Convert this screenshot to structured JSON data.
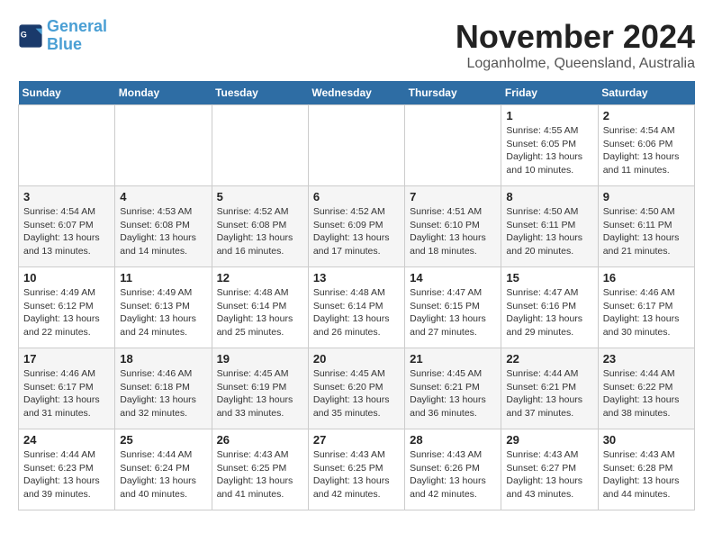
{
  "header": {
    "logo_line1": "General",
    "logo_line2": "Blue",
    "month": "November 2024",
    "location": "Loganholme, Queensland, Australia"
  },
  "weekdays": [
    "Sunday",
    "Monday",
    "Tuesday",
    "Wednesday",
    "Thursday",
    "Friday",
    "Saturday"
  ],
  "weeks": [
    [
      {
        "day": "",
        "info": ""
      },
      {
        "day": "",
        "info": ""
      },
      {
        "day": "",
        "info": ""
      },
      {
        "day": "",
        "info": ""
      },
      {
        "day": "",
        "info": ""
      },
      {
        "day": "1",
        "info": "Sunrise: 4:55 AM\nSunset: 6:05 PM\nDaylight: 13 hours\nand 10 minutes."
      },
      {
        "day": "2",
        "info": "Sunrise: 4:54 AM\nSunset: 6:06 PM\nDaylight: 13 hours\nand 11 minutes."
      }
    ],
    [
      {
        "day": "3",
        "info": "Sunrise: 4:54 AM\nSunset: 6:07 PM\nDaylight: 13 hours\nand 13 minutes."
      },
      {
        "day": "4",
        "info": "Sunrise: 4:53 AM\nSunset: 6:08 PM\nDaylight: 13 hours\nand 14 minutes."
      },
      {
        "day": "5",
        "info": "Sunrise: 4:52 AM\nSunset: 6:08 PM\nDaylight: 13 hours\nand 16 minutes."
      },
      {
        "day": "6",
        "info": "Sunrise: 4:52 AM\nSunset: 6:09 PM\nDaylight: 13 hours\nand 17 minutes."
      },
      {
        "day": "7",
        "info": "Sunrise: 4:51 AM\nSunset: 6:10 PM\nDaylight: 13 hours\nand 18 minutes."
      },
      {
        "day": "8",
        "info": "Sunrise: 4:50 AM\nSunset: 6:11 PM\nDaylight: 13 hours\nand 20 minutes."
      },
      {
        "day": "9",
        "info": "Sunrise: 4:50 AM\nSunset: 6:11 PM\nDaylight: 13 hours\nand 21 minutes."
      }
    ],
    [
      {
        "day": "10",
        "info": "Sunrise: 4:49 AM\nSunset: 6:12 PM\nDaylight: 13 hours\nand 22 minutes."
      },
      {
        "day": "11",
        "info": "Sunrise: 4:49 AM\nSunset: 6:13 PM\nDaylight: 13 hours\nand 24 minutes."
      },
      {
        "day": "12",
        "info": "Sunrise: 4:48 AM\nSunset: 6:14 PM\nDaylight: 13 hours\nand 25 minutes."
      },
      {
        "day": "13",
        "info": "Sunrise: 4:48 AM\nSunset: 6:14 PM\nDaylight: 13 hours\nand 26 minutes."
      },
      {
        "day": "14",
        "info": "Sunrise: 4:47 AM\nSunset: 6:15 PM\nDaylight: 13 hours\nand 27 minutes."
      },
      {
        "day": "15",
        "info": "Sunrise: 4:47 AM\nSunset: 6:16 PM\nDaylight: 13 hours\nand 29 minutes."
      },
      {
        "day": "16",
        "info": "Sunrise: 4:46 AM\nSunset: 6:17 PM\nDaylight: 13 hours\nand 30 minutes."
      }
    ],
    [
      {
        "day": "17",
        "info": "Sunrise: 4:46 AM\nSunset: 6:17 PM\nDaylight: 13 hours\nand 31 minutes."
      },
      {
        "day": "18",
        "info": "Sunrise: 4:46 AM\nSunset: 6:18 PM\nDaylight: 13 hours\nand 32 minutes."
      },
      {
        "day": "19",
        "info": "Sunrise: 4:45 AM\nSunset: 6:19 PM\nDaylight: 13 hours\nand 33 minutes."
      },
      {
        "day": "20",
        "info": "Sunrise: 4:45 AM\nSunset: 6:20 PM\nDaylight: 13 hours\nand 35 minutes."
      },
      {
        "day": "21",
        "info": "Sunrise: 4:45 AM\nSunset: 6:21 PM\nDaylight: 13 hours\nand 36 minutes."
      },
      {
        "day": "22",
        "info": "Sunrise: 4:44 AM\nSunset: 6:21 PM\nDaylight: 13 hours\nand 37 minutes."
      },
      {
        "day": "23",
        "info": "Sunrise: 4:44 AM\nSunset: 6:22 PM\nDaylight: 13 hours\nand 38 minutes."
      }
    ],
    [
      {
        "day": "24",
        "info": "Sunrise: 4:44 AM\nSunset: 6:23 PM\nDaylight: 13 hours\nand 39 minutes."
      },
      {
        "day": "25",
        "info": "Sunrise: 4:44 AM\nSunset: 6:24 PM\nDaylight: 13 hours\nand 40 minutes."
      },
      {
        "day": "26",
        "info": "Sunrise: 4:43 AM\nSunset: 6:25 PM\nDaylight: 13 hours\nand 41 minutes."
      },
      {
        "day": "27",
        "info": "Sunrise: 4:43 AM\nSunset: 6:25 PM\nDaylight: 13 hours\nand 42 minutes."
      },
      {
        "day": "28",
        "info": "Sunrise: 4:43 AM\nSunset: 6:26 PM\nDaylight: 13 hours\nand 42 minutes."
      },
      {
        "day": "29",
        "info": "Sunrise: 4:43 AM\nSunset: 6:27 PM\nDaylight: 13 hours\nand 43 minutes."
      },
      {
        "day": "30",
        "info": "Sunrise: 4:43 AM\nSunset: 6:28 PM\nDaylight: 13 hours\nand 44 minutes."
      }
    ]
  ]
}
